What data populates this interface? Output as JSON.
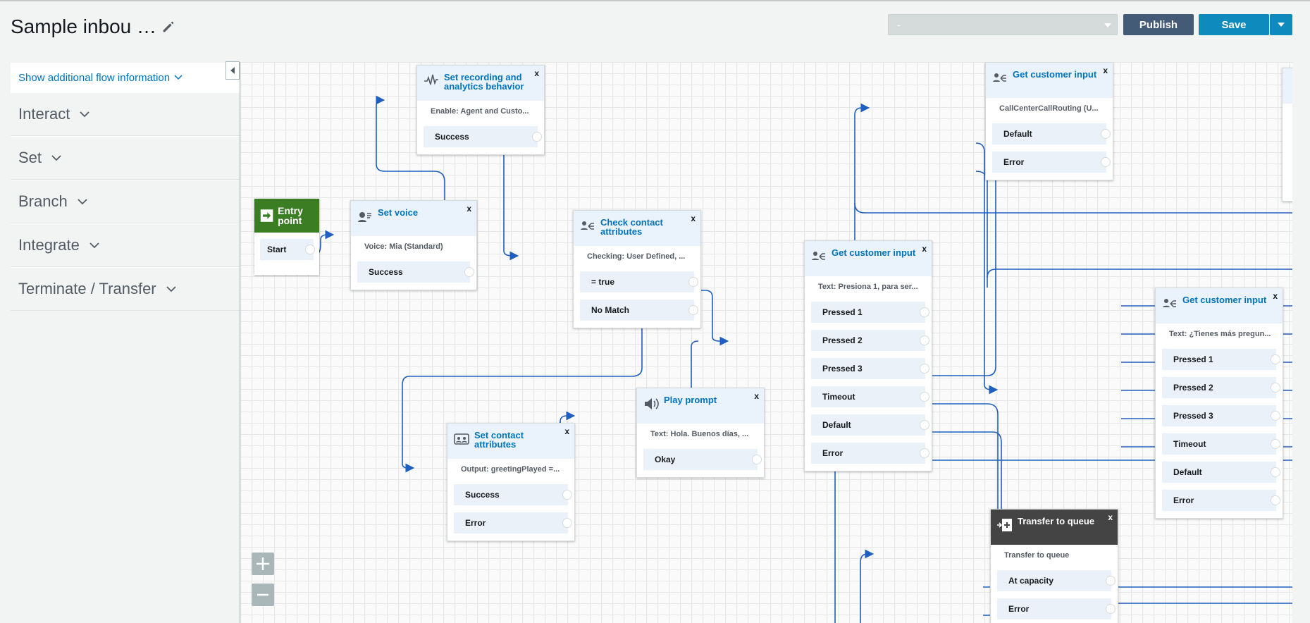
{
  "header": {
    "title": "Sample inbou …",
    "version_select": "-",
    "publish_label": "Publish",
    "save_label": "Save"
  },
  "sidebar": {
    "info_link": "Show additional flow information",
    "categories": [
      "Interact",
      "Set",
      "Branch",
      "Integrate",
      "Terminate / Transfer"
    ]
  },
  "blocks": {
    "entry": {
      "title": "Entry point",
      "outputs": [
        "Start"
      ]
    },
    "set_voice": {
      "title": "Set voice",
      "desc": "Voice: Mia (Standard)",
      "outputs": [
        "Success"
      ]
    },
    "set_recording": {
      "title": "Set recording and analytics behavior",
      "desc": "Enable: Agent and Custo...",
      "outputs": [
        "Success"
      ]
    },
    "check_contact": {
      "title": "Check contact attributes",
      "desc": "Checking: User Defined, ...",
      "outputs": [
        "= true",
        "No Match"
      ]
    },
    "set_contact": {
      "title": "Set contact attributes",
      "desc": "Output: greetingPlayed =...",
      "outputs": [
        "Success",
        "Error"
      ]
    },
    "play_prompt": {
      "title": "Play prompt",
      "desc": "Text: Hola. Buenos días, ...",
      "outputs": [
        "Okay"
      ]
    },
    "gci_main": {
      "title": "Get customer input",
      "desc": "Text: Presiona 1, para ser...",
      "outputs": [
        "Pressed 1",
        "Pressed 2",
        "Pressed 3",
        "Timeout",
        "Default",
        "Error"
      ]
    },
    "gci_top": {
      "title": "Get customer input",
      "desc": "CallCenterCallRouting (U...",
      "outputs": [
        "Default",
        "Error"
      ]
    },
    "gci_right": {
      "title": "Get customer input",
      "desc": "Text: ¿Tienes más pregun...",
      "outputs": [
        "Pressed 1",
        "Pressed 2",
        "Pressed 3",
        "Timeout",
        "Default",
        "Error"
      ]
    },
    "transfer": {
      "title": "Transfer to queue",
      "desc": "Transfer to queue",
      "outputs": [
        "At capacity",
        "Error"
      ]
    }
  },
  "close_label": "x",
  "colors": {
    "wire": "#1f5fbf",
    "accent": "#0073bb",
    "entry": "#3b7d23",
    "publish": "#445b78",
    "save": "#0f8abd"
  }
}
